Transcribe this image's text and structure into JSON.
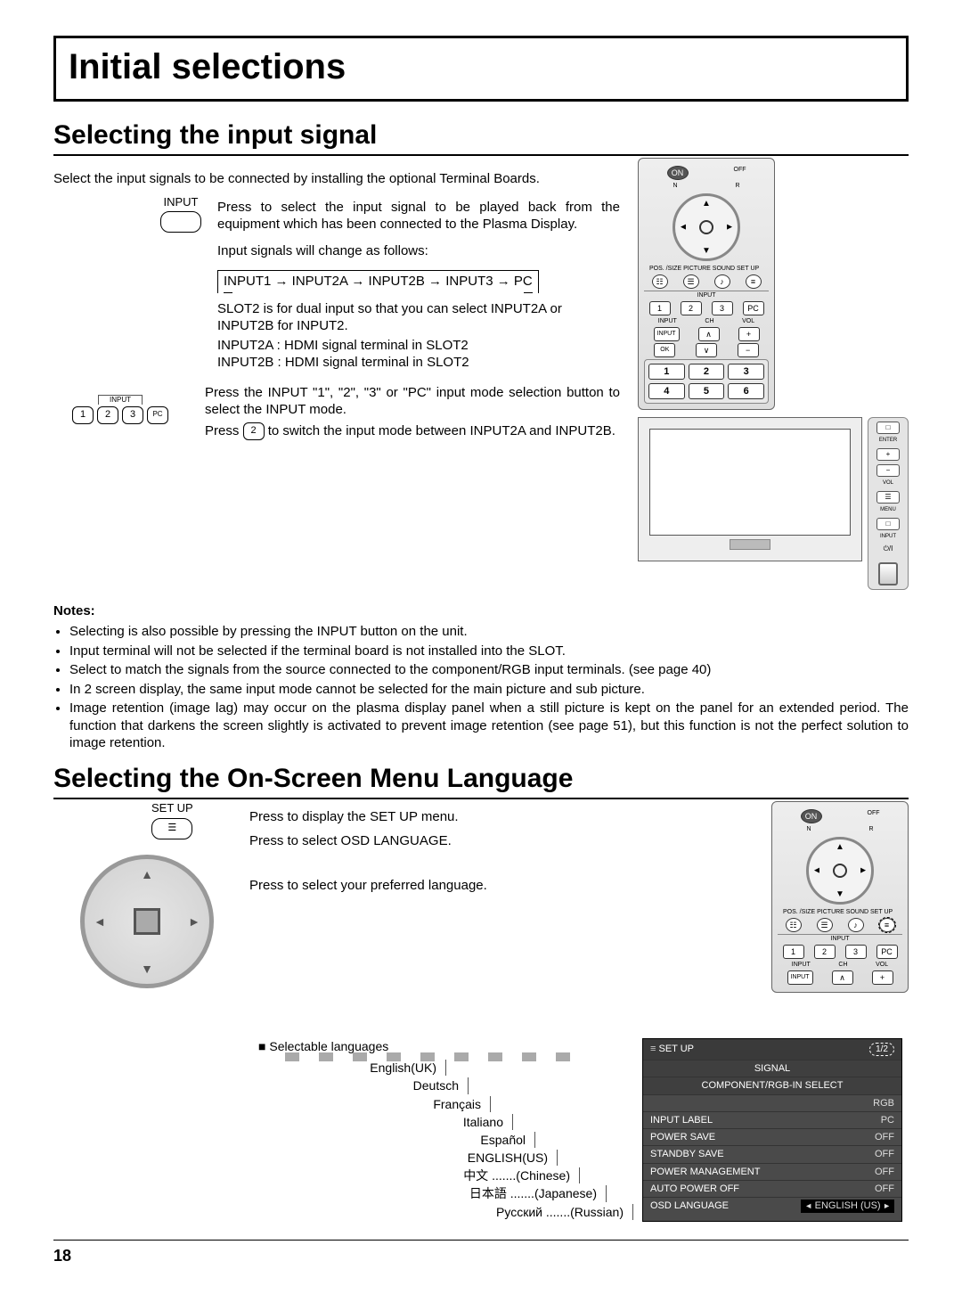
{
  "title": "Initial selections",
  "section1": {
    "heading": "Selecting the input signal",
    "intro": "Select the input signals to be connected by installing the optional Terminal Boards.",
    "input_label": "INPUT",
    "press_text": "Press to select the input signal to be played back from the equipment which has been connected to the Plasma Display.",
    "change_text": "Input signals will change as follows:",
    "flow": "INPUT1 → INPUT2A → INPUT2B → INPUT3 → PC",
    "slot2_text1": "SLOT2 is for dual input so that you can select INPUT2A or INPUT2B for INPUT2.",
    "slot2_text2": "INPUT2A : HDMI signal terminal in SLOT2",
    "slot2_text3": "INPUT2B : HDMI signal terminal in SLOT2",
    "btns_label": "INPUT",
    "btns_text1": "Press the INPUT \"1\", \"2\", \"3\" or \"PC\" input mode selection button to select the INPUT mode.",
    "btns_text2_a": "Press ",
    "btns_text2_b": " to switch the input mode between INPUT2A and INPUT2B.",
    "notes_head": "Notes:",
    "notes": [
      "Selecting is also possible by pressing the INPUT button on the unit.",
      "Input terminal will not be selected if the terminal board is not installed into the SLOT.",
      "Select to match the signals from the source connected to the component/RGB input terminals. (see page 40)",
      "In 2 screen display, the same input mode cannot be selected for the main picture and sub picture.",
      "Image retention (image lag) may occur on the plasma display panel when a still picture is kept on the panel for an extended period. The function that darkens the screen slightly is activated to prevent image retention (see page 51), but this function is not the perfect solution to image retention."
    ]
  },
  "section2": {
    "heading": "Selecting the On-Screen Menu Language",
    "setup_label": "SET UP",
    "step1": "Press to display the SET UP menu.",
    "step2": "Press to select OSD LANGUAGE.",
    "step3": "Press to select your preferred language.",
    "lang_head": "Selectable languages",
    "langs": {
      "l1": "English(UK)",
      "l2": "Deutsch",
      "l3": "Français",
      "l4": "Italiano",
      "l5": "Español",
      "l6": "ENGLISH(US)",
      "l7": "中文 .......(Chinese)",
      "l8": "日本語 .......(Japanese)",
      "l9": "Русский .......(Russian)"
    }
  },
  "osd": {
    "title": "SET UP",
    "page": "1/2",
    "rows": {
      "signal": "SIGNAL",
      "comprgb": "COMPONENT/RGB-IN SELECT",
      "rgb_val": "RGB",
      "inputlabel": "INPUT LABEL",
      "inputlabel_val": "PC",
      "powersave": "POWER SAVE",
      "powersave_val": "OFF",
      "standby": "STANDBY SAVE",
      "standby_val": "OFF",
      "pwrmgmt": "POWER MANAGEMENT",
      "pwrmgmt_val": "OFF",
      "autopwr": "AUTO POWER OFF",
      "autopwr_val": "OFF",
      "osdlang": "OSD LANGUAGE",
      "osdlang_val": "ENGLISH (US)"
    }
  },
  "remote": {
    "on": "ON",
    "off": "OFF",
    "n": "N",
    "r": "R",
    "labels": "POS. /SIZE PICTURE SOUND SET UP",
    "input_label": "INPUT",
    "btns": {
      "b1": "1",
      "b2": "2",
      "b3": "3",
      "pc": "PC",
      "inp": "INPUT",
      "ch": "CH",
      "vol": "VOL",
      "ok": "OK",
      "plus": "+",
      "minus": "−"
    },
    "nums": {
      "n1": "1",
      "n2": "2",
      "n3": "3",
      "n4": "4",
      "n5": "5",
      "n6": "6"
    }
  },
  "sidepanel": {
    "enter": "ENTER",
    "menu": "MENU",
    "input": "INPUT",
    "vol": "VOL",
    "plus": "+",
    "minus": "−",
    "up": "▲",
    "down": "▼",
    "pwr": "⏻/I"
  },
  "page_number": "18"
}
